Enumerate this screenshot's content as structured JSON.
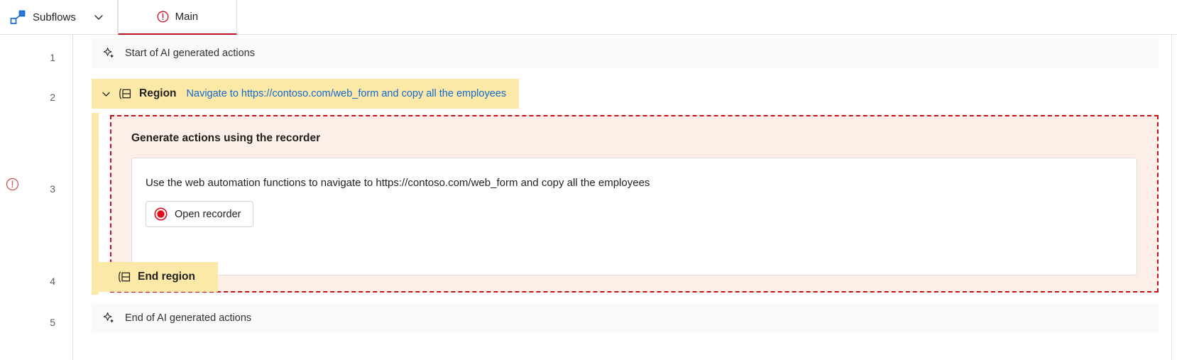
{
  "topbar": {
    "subflows_label": "Subflows",
    "subflows_icon": "subflows-icon",
    "chevron_icon": "chevron-down-icon",
    "tab": {
      "label": "Main",
      "status_icon": "error-circle-icon",
      "accent_color": "#c50f1f"
    }
  },
  "gutter": {
    "line_numbers": [
      "1",
      "2",
      "3",
      "4",
      "5"
    ],
    "error_marker_row": "3",
    "error_icon": "error-circle-icon"
  },
  "rows": [
    {
      "number": "1",
      "kind": "ai-marker",
      "icon": "ai-sparkle-icon",
      "label": "Start of AI generated actions"
    },
    {
      "number": "2",
      "kind": "region-start",
      "collapse_icon": "chevron-down-icon",
      "icon": "region-icon",
      "label": "Region",
      "description": "Navigate to https://contoso.com/web_form and copy all the employees"
    },
    {
      "number": "3",
      "kind": "recorder-callout",
      "title": "Generate actions using the recorder",
      "instruction": "Use the web automation functions to navigate to https://contoso.com/web_form and copy all the employees",
      "button_label": "Open recorder",
      "button_icon": "record-circle-icon"
    },
    {
      "number": "4",
      "kind": "region-end",
      "icon": "region-icon",
      "label": "End region"
    },
    {
      "number": "5",
      "kind": "ai-marker",
      "icon": "ai-sparkle-icon",
      "label": "End of AI generated actions"
    }
  ],
  "colors": {
    "region_yellow": "#fce9a8",
    "ai_row_grey": "#faf9f8",
    "callout_bg": "#fdeee7",
    "callout_border": "#c50f1f",
    "link_blue": "#1268cf",
    "record_red": "#e00b1c"
  }
}
